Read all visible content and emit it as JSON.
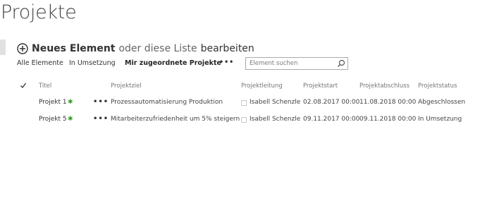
{
  "page": {
    "title": "Projekte"
  },
  "command_bar": {
    "new_label": "Neues Element",
    "or_text": "oder diese Liste",
    "edit_label": "bearbeiten"
  },
  "views": {
    "all": "Alle Elemente",
    "in_progress": "In Umsetzung",
    "assigned": "Mir zugeordnete Projekte",
    "more": "•••"
  },
  "search": {
    "placeholder": "Element suchen"
  },
  "table": {
    "columns": {
      "title": "Titel",
      "goal": "Projektziel",
      "lead": "Projektleitung",
      "start": "Projektstart",
      "end": "Projektabschluss",
      "status": "Projektstatus"
    },
    "rows": [
      {
        "title": "Projekt 1",
        "new_marker": "✱",
        "menu": "•••",
        "goal": "Prozessautomatisierung Produktion",
        "lead": "Isabell Schenzle",
        "start": "02.08.2017 00:00",
        "end": "11.08.2018 00:00",
        "status": "Abgeschlossen"
      },
      {
        "title": "Projekt 5",
        "new_marker": "✱",
        "menu": "•••",
        "goal": "Mitarbeiterzufriedenheit um 5% steigern",
        "lead": "Isabell Schenzle",
        "start": "09.11.2017 00:00",
        "end": "09.11.2018 00:00",
        "status": "In Umsetzung"
      }
    ]
  },
  "colors": {
    "new_marker": "#3c9d2f",
    "text": "#444444",
    "header_text": "#777777"
  }
}
